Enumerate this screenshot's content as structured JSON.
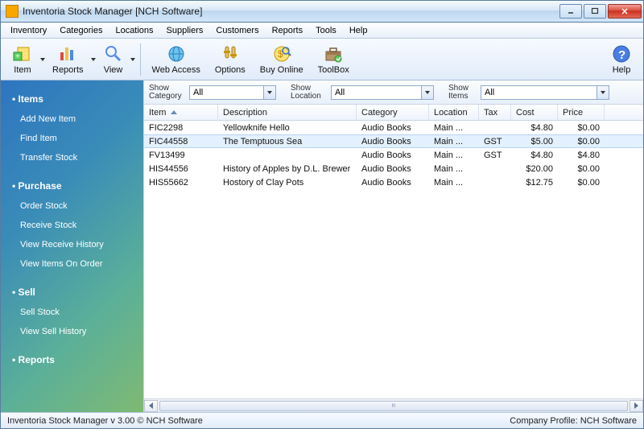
{
  "window": {
    "title": "Inventoria Stock Manager [NCH Software]"
  },
  "menubar": [
    "Inventory",
    "Categories",
    "Locations",
    "Suppliers",
    "Customers",
    "Reports",
    "Tools",
    "Help"
  ],
  "toolbar": {
    "item": "Item",
    "reports": "Reports",
    "view": "View",
    "web_access": "Web Access",
    "options": "Options",
    "buy_online": "Buy Online",
    "toolbox": "ToolBox",
    "help": "Help"
  },
  "filters": {
    "category_label": "Show Category",
    "category_value": "All",
    "location_label": "Show Location",
    "location_value": "All",
    "items_label": "Show Items",
    "items_value": "All"
  },
  "columns": [
    "Item",
    "Description",
    "Category",
    "Location",
    "Tax",
    "Cost",
    "Price"
  ],
  "rows": [
    {
      "item": "FIC2298",
      "desc": "Yellowknife Hello",
      "cat": "Audio Books",
      "loc": "Main ...",
      "tax": "",
      "cost": "$4.80",
      "price": "$0.00",
      "selected": false
    },
    {
      "item": "FIC44558",
      "desc": "The Temptuous Sea",
      "cat": "Audio Books",
      "loc": "Main ...",
      "tax": "GST",
      "cost": "$5.00",
      "price": "$0.00",
      "selected": true
    },
    {
      "item": "FV13499",
      "desc": "",
      "cat": "Audio Books",
      "loc": "Main ...",
      "tax": "GST",
      "cost": "$4.80",
      "price": "$4.80",
      "selected": false
    },
    {
      "item": "HIS44556",
      "desc": "History of Apples by D.L. Brewer",
      "cat": "Audio Books",
      "loc": "Main ...",
      "tax": "",
      "cost": "$20.00",
      "price": "$0.00",
      "selected": false
    },
    {
      "item": "HIS55662",
      "desc": "Hostory of Clay Pots",
      "cat": "Audio Books",
      "loc": "Main ...",
      "tax": "",
      "cost": "$12.75",
      "price": "$0.00",
      "selected": false
    }
  ],
  "sidebar": {
    "groups": [
      {
        "title": "Items",
        "items": [
          "Add New Item",
          "Find Item",
          "Transfer Stock"
        ]
      },
      {
        "title": "Purchase",
        "items": [
          "Order Stock",
          "Receive Stock",
          "View Receive History",
          "View Items On Order"
        ]
      },
      {
        "title": "Sell",
        "items": [
          "Sell Stock",
          "View Sell History"
        ]
      },
      {
        "title": "Reports",
        "items": []
      }
    ]
  },
  "statusbar": {
    "left": "Inventoria Stock Manager v 3.00 © NCH Software",
    "right": "Company Profile: NCH Software"
  }
}
